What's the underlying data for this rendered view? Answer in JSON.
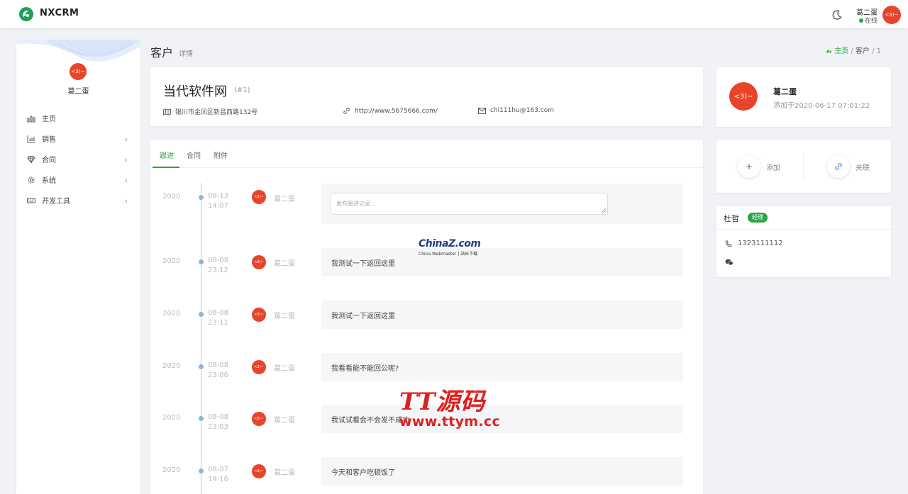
{
  "app": {
    "brand": "NXCRM"
  },
  "topbar": {
    "user_name": "葛二蛋",
    "user_status": "在线",
    "avatar_text": "<3)~"
  },
  "sidebar": {
    "user_name": "葛二蛋",
    "avatar_text": "<3)~",
    "items": [
      {
        "label": "主页",
        "icon": "chart-bar-icon",
        "has_children": false
      },
      {
        "label": "销售",
        "icon": "bar-chart-icon",
        "has_children": true
      },
      {
        "label": "合同",
        "icon": "diamond-icon",
        "has_children": true
      },
      {
        "label": "系统",
        "icon": "gear-icon",
        "has_children": true
      },
      {
        "label": "开发工具",
        "icon": "keyboard-icon",
        "has_children": true
      }
    ],
    "chevron": "‹"
  },
  "page": {
    "title": "客户",
    "subtitle": "详情"
  },
  "breadcrumb": {
    "home": "主页",
    "sep": "/",
    "section": "客户",
    "current": "1"
  },
  "customer": {
    "name": "当代软件网",
    "id": "(#1)",
    "address": "银川市金凤区新昌西路132号",
    "website": "http://www.5675666.com/",
    "email": "chi111hu@163.com"
  },
  "profile": {
    "avatar_text": "<3)~",
    "name": "葛二蛋",
    "added": "添加于2020-06-17 07:01:22"
  },
  "actions": {
    "add": "添加",
    "add_symbol": "+",
    "link": "关联"
  },
  "contact": {
    "name": "杜哲",
    "badge": "经理",
    "phone": "1323111112"
  },
  "tabs": [
    {
      "label": "跟进"
    },
    {
      "label": "合同"
    },
    {
      "label": "附件"
    }
  ],
  "timeline": {
    "input_placeholder": "发布跟进记录...",
    "entries": [
      {
        "year": "2020",
        "date": "08-13",
        "time": "14:07",
        "avatar_text": "<3)~",
        "user": "葛二蛋",
        "content": ""
      },
      {
        "year": "2020",
        "date": "08-08",
        "time": "23:12",
        "avatar_text": "<3)~",
        "user": "葛二蛋",
        "content": "我测试一下返回这里"
      },
      {
        "year": "2020",
        "date": "08-08",
        "time": "23:11",
        "avatar_text": "<3)~",
        "user": "葛二蛋",
        "content": "我测试一下返回这里"
      },
      {
        "year": "2020",
        "date": "08-08",
        "time": "23:06",
        "avatar_text": "<3)~",
        "user": "葛二蛋",
        "content": "我看看能不能回公呢?"
      },
      {
        "year": "2020",
        "date": "08-08",
        "time": "23:03",
        "avatar_text": "<3)~",
        "user": "葛二蛋",
        "content": "我试试看会不会发不成功"
      },
      {
        "year": "2020",
        "date": "08-07",
        "time": "19:16",
        "avatar_text": "<3)~",
        "user": "葛二蛋",
        "content": "今天和客户吃顿饭了"
      }
    ]
  },
  "watermarks": {
    "china_main": "ChinaZ.com",
    "china_sub": "China Webmaster | 站长下载",
    "tt_main": "TT源码",
    "tt_url": "www.ttym.cc"
  },
  "colors": {
    "accent": "#28a745",
    "avatar": "#e8442b",
    "timeline": "#8fb3e0"
  }
}
